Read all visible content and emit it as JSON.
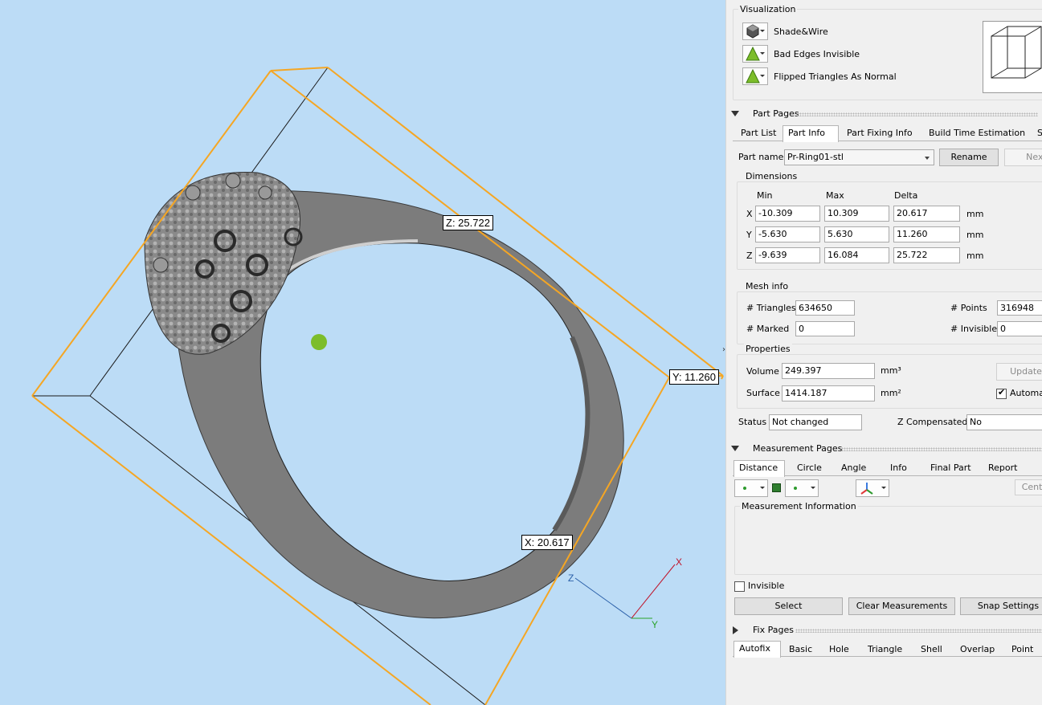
{
  "viewport": {
    "labels": {
      "z": "Z: 25.722",
      "y": "Y: 11.260",
      "x": "X: 20.617"
    },
    "axis": {
      "x": "X",
      "y": "Y",
      "z": "Z"
    },
    "colors": {
      "background": "#bcdcf6",
      "bbox": "#f5a623",
      "ring": "#7c7c7c",
      "marker": "#7cbd2a"
    }
  },
  "visualization": {
    "title": "Visualization",
    "rows": [
      {
        "icon": "shaded-cube-icon",
        "label": "Shade&Wire"
      },
      {
        "icon": "green-triangle-icon",
        "label": "Bad Edges Invisible"
      },
      {
        "icon": "green-triangle-icon",
        "label": "Flipped Triangles As Normal"
      }
    ]
  },
  "part_pages": {
    "title": "Part Pages",
    "tabs": [
      "Part List",
      "Part Info",
      "Part Fixing Info",
      "Build Time Estimation",
      "St"
    ],
    "active_tab": "Part Info",
    "part_name_label": "Part name",
    "part_name": "Pr-Ring01-stl",
    "rename": "Rename",
    "next": "Next",
    "dimensions": {
      "title": "Dimensions",
      "headers": [
        "Min",
        "Max",
        "Delta"
      ],
      "rows": [
        {
          "axis": "X",
          "min": "-10.309",
          "max": "10.309",
          "delta": "20.617",
          "unit": "mm"
        },
        {
          "axis": "Y",
          "min": "-5.630",
          "max": "5.630",
          "delta": "11.260",
          "unit": "mm"
        },
        {
          "axis": "Z",
          "min": "-9.639",
          "max": "16.084",
          "delta": "25.722",
          "unit": "mm"
        }
      ]
    },
    "mesh": {
      "title": "Mesh info",
      "triangles_label": "# Triangles",
      "triangles": "634650",
      "points_label": "# Points",
      "points": "316948",
      "marked_label": "# Marked",
      "marked": "0",
      "invisible_label": "# Invisible",
      "invisible": "0"
    },
    "properties": {
      "title": "Properties",
      "volume_label": "Volume",
      "volume": "249.397",
      "volume_unit": "mm³",
      "surface_label": "Surface",
      "surface": "1414.187",
      "surface_unit": "mm²",
      "update": "Update",
      "auto_label": "Automa"
    },
    "status_label": "Status",
    "status": "Not changed",
    "zcomp_label": "Z Compensated",
    "zcomp": "No"
  },
  "measurement_pages": {
    "title": "Measurement Pages",
    "tabs": [
      "Distance",
      "Circle",
      "Angle",
      "Info",
      "Final Part",
      "Report"
    ],
    "active_tab": "Distance",
    "center": "Cente",
    "info_title": "Measurement Information",
    "invisible_label": "Invisible",
    "select": "Select",
    "clear": "Clear Measurements",
    "snap": "Snap Settings"
  },
  "fix_pages": {
    "title": "Fix Pages",
    "tabs": [
      "Autofix",
      "Basic",
      "Hole",
      "Triangle",
      "Shell",
      "Overlap",
      "Point"
    ],
    "active_tab": "Autofix"
  }
}
